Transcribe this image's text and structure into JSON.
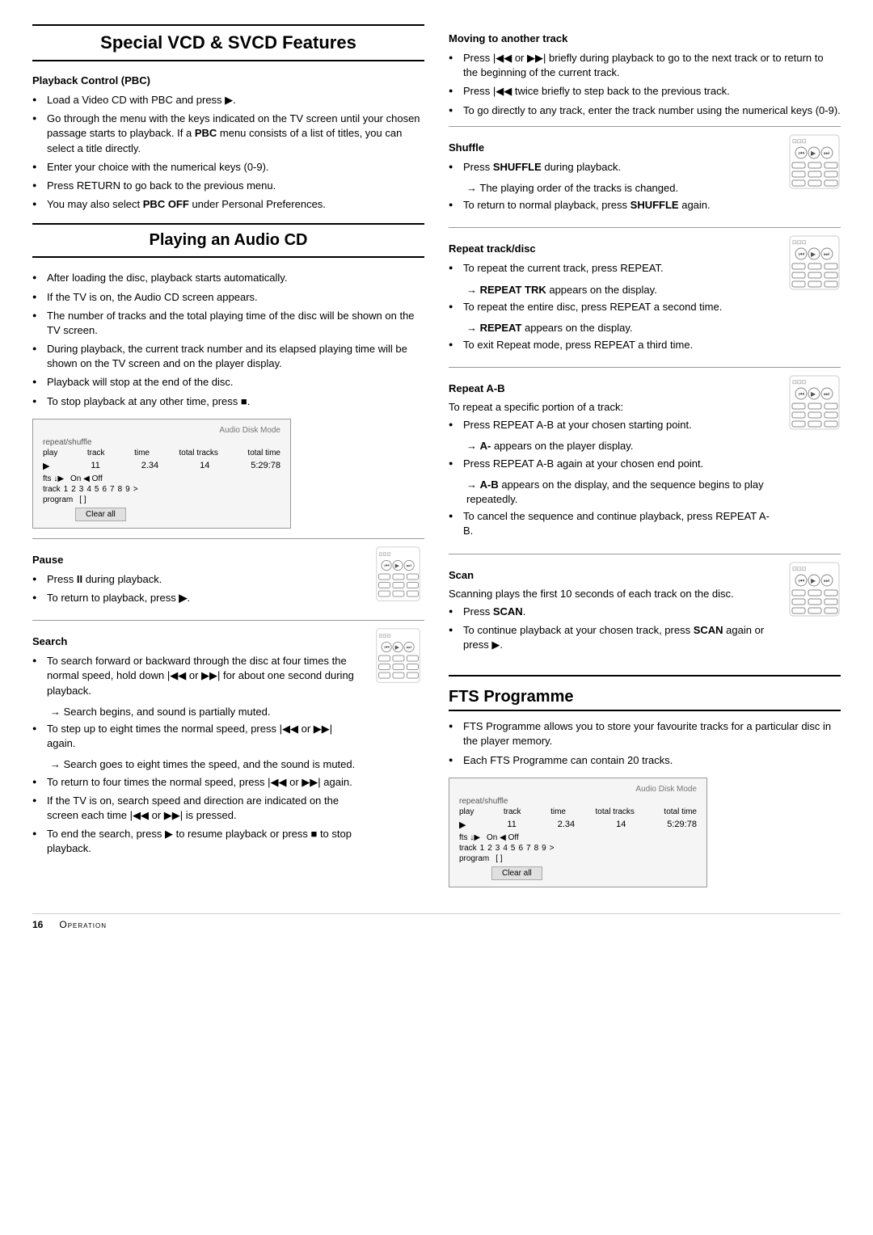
{
  "page": {
    "left_title": "Special VCD & SVCD Features",
    "sections": {
      "pbc": {
        "title": "Playback Control (PBC)",
        "items": [
          "Load a Video CD with PBC and press ▶.",
          "Go through the menu with the keys indicated on the TV screen until your chosen passage starts to playback. If a PBC menu consists of a list of titles, you can select a title directly.",
          "Enter your choice with the numerical keys (0-9).",
          "Press RETURN to go back to the previous menu.",
          "You may also select PBC OFF under Personal Preferences."
        ]
      },
      "audio_cd": {
        "title": "Playing an Audio CD",
        "items": [
          "After loading the disc, playback starts automatically.",
          "If the TV is on, the Audio CD screen appears.",
          "The number of tracks and the total playing time of the disc will be shown on the TV screen.",
          "During playback, the current track number and its elapsed playing time will be shown on the TV screen and on the player display.",
          "Playback will stop at the end of the disc.",
          "To stop playback at any other time, press ■."
        ]
      },
      "pause": {
        "title": "Pause",
        "items": [
          "Press II during playback.",
          "To return to playback, press ▶."
        ]
      },
      "search": {
        "title": "Search",
        "items": [
          "To search forward or backward through the disc at four times the normal speed, hold down |◀◀ or ▶▶| for about one second during playback.",
          "Search begins, and sound is partially muted.",
          "To step up to eight times the normal speed, press |◀◀ or ▶▶| again.",
          "Search goes to eight times the speed, and the sound is muted.",
          "To return to four times the normal speed, press |◀◀ or ▶▶| again.",
          "If the TV is on, search speed and direction are indicated on the screen each time |◀◀ or ▶▶| is pressed.",
          "To end the search, press ▶ to resume playback or press ■ to stop playback."
        ],
        "arrow_items": [
          "Search begins, and sound is partially muted.",
          "Search goes to eight times the speed, and the sound is muted."
        ]
      }
    },
    "display_box": {
      "mode_label": "Audio Disk Mode",
      "repeat_shuffle": "repeat/shuffle",
      "columns": [
        "play",
        "track",
        "time",
        "total tracks",
        "total time"
      ],
      "data": [
        "▶",
        "11",
        "2.34",
        "14",
        "5:29:78"
      ],
      "fts_row": [
        "fts ↓▶",
        "On ◀ Off"
      ],
      "tracks_row": [
        "track",
        "1",
        "2",
        "3",
        "4",
        "5",
        "6",
        "7",
        "8",
        "9",
        ">"
      ],
      "program_row": [
        "program",
        "[ ]"
      ],
      "clear_btn": "Clear all"
    },
    "right_sections": {
      "moving": {
        "title": "Moving to another track",
        "items": [
          "Press |◀◀ or ▶▶| briefly during playback to go to the next track or to return to the beginning of the current track.",
          "Press |◀◀ twice briefly to step back to the previous track.",
          "To go directly to any track, enter the track number using the numerical keys (0-9)."
        ]
      },
      "shuffle": {
        "title": "Shuffle",
        "items": [
          "Press SHUFFLE during playback.",
          "To return to normal playback, press SHUFFLE again."
        ],
        "arrow_items": [
          "The playing order of the tracks is changed."
        ]
      },
      "repeat_track": {
        "title": "Repeat track/disc",
        "items": [
          "To repeat the current track, press REPEAT.",
          "To repeat the entire disc, press REPEAT a second time.",
          "To exit Repeat mode, press REPEAT a third time."
        ],
        "arrow_items": [
          "REPEAT TRK appears on the display.",
          "REPEAT appears on the display."
        ]
      },
      "repeat_ab": {
        "title": "Repeat A-B",
        "intro": "To repeat a specific portion of a track:",
        "items": [
          "Press REPEAT A-B at your chosen starting point.",
          "Press REPEAT A-B again at your chosen end point.",
          "To cancel the sequence and continue playback, press REPEAT A-B."
        ],
        "arrow_items": [
          "A- appears on the player display.",
          "A-B appears on the display, and the sequence begins to play repeatedly."
        ]
      },
      "scan": {
        "title": "Scan",
        "intro": "Scanning plays the first 10 seconds of each track on the disc.",
        "items": [
          "Press SCAN.",
          "To continue playback at your chosen track, press SCAN again or press ▶."
        ]
      }
    },
    "fts": {
      "title": "FTS Programme",
      "items": [
        "FTS Programme allows you to store your favourite tracks for a particular disc in the player memory.",
        "Each FTS Programme can contain 20 tracks."
      ]
    },
    "footer": {
      "page": "16",
      "label": "Operation"
    }
  }
}
